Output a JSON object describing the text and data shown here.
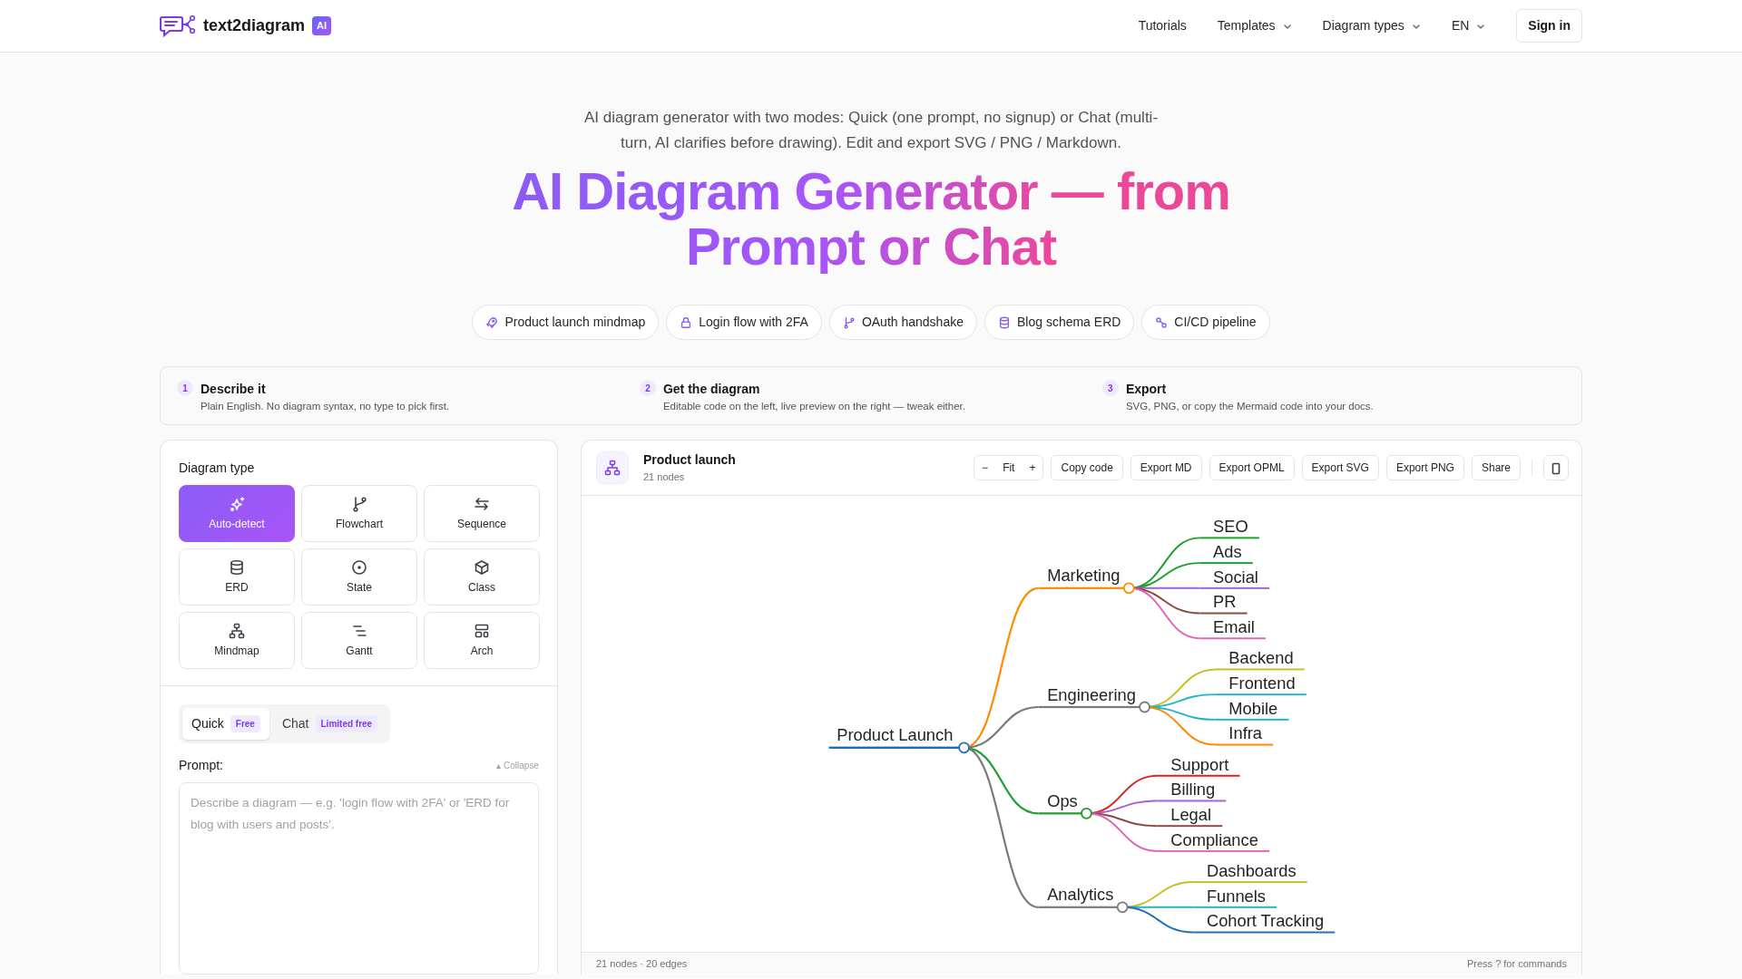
{
  "header": {
    "logo_text": "text2diagram",
    "logo_badge": "AI",
    "nav": [
      {
        "label": "Tutorials",
        "dropdown": false
      },
      {
        "label": "Templates",
        "dropdown": true
      },
      {
        "label": "Diagram types",
        "dropdown": true
      },
      {
        "label": "EN",
        "dropdown": true
      }
    ],
    "sign_in": "Sign in"
  },
  "hero": {
    "subtitle": "AI diagram generator with two modes: Quick (one prompt, no signup) or Chat (multi-turn, AI clarifies before drawing). Edit and export SVG / PNG / Markdown.",
    "title_line_1": "AI Diagram Generator — from",
    "title_line_2": "Prompt or Chat"
  },
  "examples": [
    {
      "label": "Product launch mindmap"
    },
    {
      "label": "Login flow with 2FA"
    },
    {
      "label": "OAuth handshake"
    },
    {
      "label": "Blog schema ERD"
    },
    {
      "label": "CI/CD pipeline"
    }
  ],
  "steps": [
    {
      "number": "1",
      "title": "Describe it",
      "text": "Plain English. No diagram syntax, no type to pick first."
    },
    {
      "number": "2",
      "title": "Get the diagram",
      "text": "Editable code on the left, live preview on the right — tweak either."
    },
    {
      "number": "3",
      "title": "Export",
      "text": "SVG, PNG, or copy the Mermaid code into your docs."
    }
  ],
  "diagram_types": {
    "heading": "Diagram type",
    "items": [
      {
        "label": "Auto-detect",
        "selected": true
      },
      {
        "label": "Flowchart",
        "selected": false
      },
      {
        "label": "Sequence",
        "selected": false
      },
      {
        "label": "ERD",
        "selected": false
      },
      {
        "label": "State",
        "selected": false
      },
      {
        "label": "Class",
        "selected": false
      },
      {
        "label": "Mindmap",
        "selected": false
      },
      {
        "label": "Gantt",
        "selected": false
      },
      {
        "label": "Arch",
        "selected": false
      }
    ]
  },
  "mode_tabs": [
    {
      "label": "Quick",
      "badge": "Free",
      "selected": true
    },
    {
      "label": "Chat",
      "badge": "Limited free",
      "selected": false
    }
  ],
  "prompt": {
    "label": "Prompt:",
    "collapse": "▴ Collapse",
    "placeholder": "Describe a diagram — e.g. 'login flow with 2FA' or 'ERD for blog with users and posts'."
  },
  "preview": {
    "title": "Product launch",
    "subtitle": "21 nodes",
    "zoom_out": "−",
    "fit": "Fit",
    "zoom_in": "+",
    "actions": [
      "Copy code",
      "Export MD",
      "Export OPML",
      "Export SVG",
      "Export PNG",
      "Share"
    ],
    "footer_left": "21 nodes · 20 edges",
    "footer_right": "Press ? for commands"
  },
  "mindmap": {
    "label": "Product Launch",
    "color": "#1f6fb8",
    "children": [
      {
        "label": "Marketing",
        "color": "#ff8a00",
        "children": [
          {
            "label": "SEO",
            "color": "#1e9e2e"
          },
          {
            "label": "Ads",
            "color": "#1e9e2e"
          },
          {
            "label": "Social",
            "color": "#a25fd6"
          },
          {
            "label": "PR",
            "color": "#8c4a3a"
          },
          {
            "label": "Email",
            "color": "#e264b4"
          }
        ]
      },
      {
        "label": "Engineering",
        "color": "#7a7a7a",
        "children": [
          {
            "label": "Backend",
            "color": "#c6bf22"
          },
          {
            "label": "Frontend",
            "color": "#1fb5cf"
          },
          {
            "label": "Mobile",
            "color": "#1fb5cf"
          },
          {
            "label": "Infra",
            "color": "#ff8a00"
          }
        ]
      },
      {
        "label": "Ops",
        "color": "#1e9e2e",
        "children": [
          {
            "label": "Support",
            "color": "#e01f1f"
          },
          {
            "label": "Billing",
            "color": "#a25fd6"
          },
          {
            "label": "Legal",
            "color": "#8c4a3a"
          },
          {
            "label": "Compliance",
            "color": "#e264b4"
          }
        ]
      },
      {
        "label": "Analytics",
        "color": "#7a7a7a",
        "children": [
          {
            "label": "Dashboards",
            "color": "#c6bf22"
          },
          {
            "label": "Funnels",
            "color": "#1fb5cf"
          },
          {
            "label": "Cohort Tracking",
            "color": "#1f6fb8"
          }
        ]
      }
    ]
  }
}
